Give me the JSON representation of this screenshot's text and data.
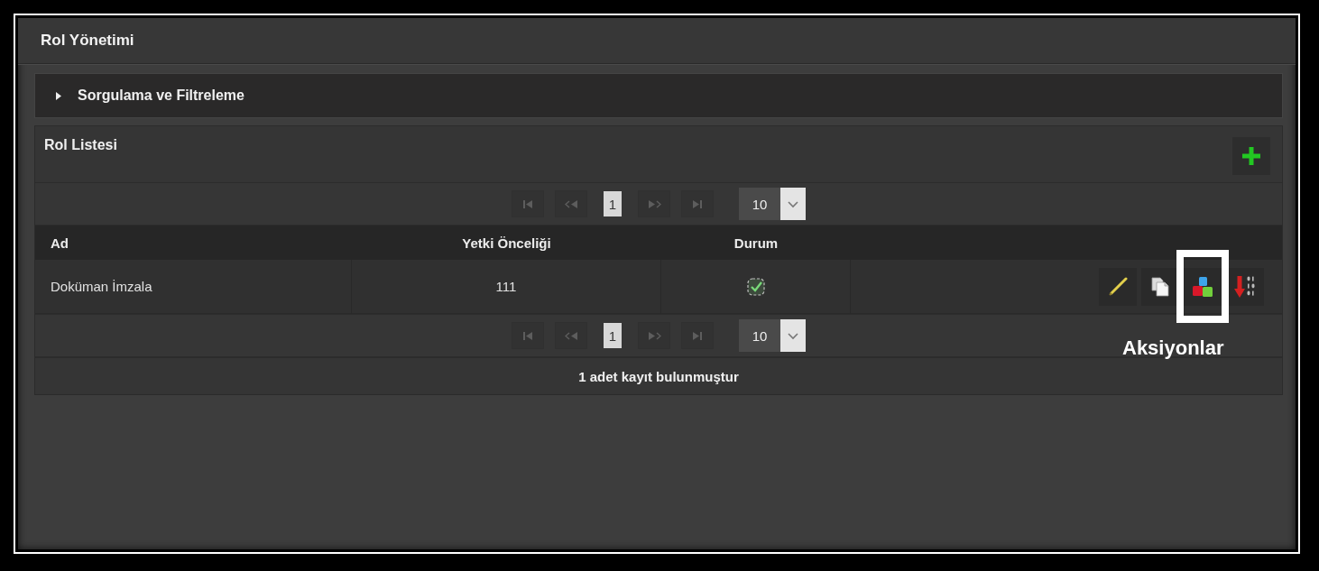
{
  "panel": {
    "title": "Rol Yönetimi"
  },
  "filter_section": {
    "title": "Sorgulama ve Filtreleme",
    "expanded": false
  },
  "list_section": {
    "title": "Rol Listesi"
  },
  "paginators": [
    {
      "nav": [
        {
          "kind": "first",
          "disabled": true
        },
        {
          "kind": "prev",
          "disabled": true
        },
        {
          "kind": "next",
          "disabled": true
        },
        {
          "kind": "last",
          "disabled": true
        }
      ],
      "pages": [
        {
          "label": "1",
          "selected": true
        }
      ],
      "page_size": "10"
    },
    {
      "nav": [
        {
          "kind": "first",
          "disabled": true
        },
        {
          "kind": "prev",
          "disabled": true
        },
        {
          "kind": "next",
          "disabled": true
        },
        {
          "kind": "last",
          "disabled": true
        }
      ],
      "pages": [
        {
          "label": "1",
          "selected": true
        }
      ],
      "page_size": "10"
    }
  ],
  "table": {
    "columns": [
      "Ad",
      "Yetki Önceliği",
      "Durum"
    ],
    "rows": [
      {
        "name": "Doküman İmzala",
        "priority": "111",
        "active": true,
        "actions": [
          {
            "kind": "edit",
            "highlighted": false
          },
          {
            "kind": "copy",
            "highlighted": false
          },
          {
            "kind": "blocks",
            "highlighted": true,
            "callout": "Aksiyonlar"
          },
          {
            "kind": "sort",
            "highlighted": false
          }
        ]
      }
    ]
  },
  "footer": {
    "record_count": "1 adet kayıt bulunmuştur"
  }
}
